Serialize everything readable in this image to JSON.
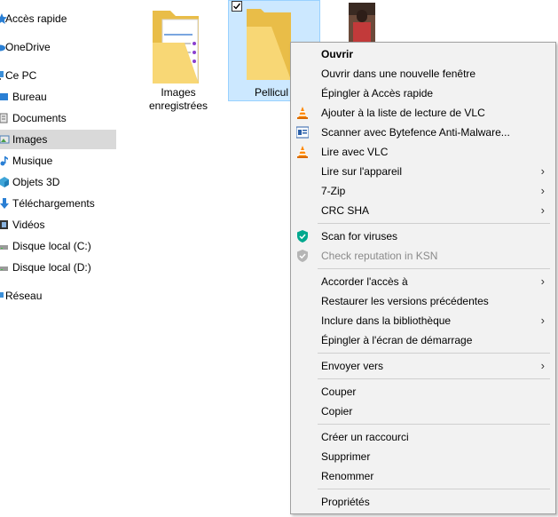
{
  "nav": {
    "items": [
      {
        "label": "Accès rapide",
        "icon": "star-icon"
      },
      {
        "label": "OneDrive",
        "icon": "cloud-icon"
      },
      {
        "label": "Ce PC",
        "icon": "computer-icon"
      },
      {
        "label": "Bureau",
        "icon": "desktop-icon"
      },
      {
        "label": "Documents",
        "icon": "documents-icon"
      },
      {
        "label": "Images",
        "icon": "pictures-icon"
      },
      {
        "label": "Musique",
        "icon": "music-icon"
      },
      {
        "label": "Objets 3D",
        "icon": "cube-icon"
      },
      {
        "label": "Téléchargements",
        "icon": "download-icon"
      },
      {
        "label": "Vidéos",
        "icon": "video-icon"
      },
      {
        "label": "Disque local (C:)",
        "icon": "drive-icon"
      },
      {
        "label": "Disque local (D:)",
        "icon": "drive-icon"
      },
      {
        "label": "Réseau",
        "icon": "network-icon"
      }
    ],
    "selected": "Images"
  },
  "files": {
    "images_enregistrees": {
      "line1": "Images",
      "line2": "enregistrées"
    },
    "pellicule": {
      "label": "Pellicul"
    }
  },
  "context_menu": {
    "items": [
      {
        "label": "Ouvrir",
        "bold": true
      },
      {
        "label": "Ouvrir dans une nouvelle fenêtre"
      },
      {
        "label": "Épingler à Accès rapide"
      },
      {
        "label": "Ajouter à la liste de lecture de VLC",
        "icon": "vlc-icon"
      },
      {
        "label": "Scanner avec Bytefence Anti-Malware...",
        "icon": "bytefence-icon"
      },
      {
        "label": "Lire avec VLC",
        "icon": "vlc-icon"
      },
      {
        "label": "Lire sur l'appareil",
        "submenu": true
      },
      {
        "label": "7-Zip",
        "submenu": true
      },
      {
        "label": "CRC SHA",
        "submenu": true
      },
      {
        "label": "Scan for viruses",
        "icon": "kaspersky-shield-icon"
      },
      {
        "label": "Check reputation in KSN",
        "icon": "kaspersky-shield-gray-icon",
        "disabled": true
      },
      {
        "label": "Accorder l'accès à",
        "submenu": true
      },
      {
        "label": "Restaurer les versions précédentes"
      },
      {
        "label": "Inclure dans la bibliothèque",
        "submenu": true
      },
      {
        "label": "Épingler à l'écran de démarrage"
      },
      {
        "label": "Envoyer vers",
        "submenu": true
      },
      {
        "label": "Couper"
      },
      {
        "label": "Copier"
      },
      {
        "label": "Créer un raccourci"
      },
      {
        "label": "Supprimer"
      },
      {
        "label": "Renommer"
      },
      {
        "label": "Propriétés"
      }
    ],
    "arrow": "›"
  },
  "colors": {
    "selection": "#cce8ff",
    "nav_selected": "#d9d9d9",
    "menu_bg": "#f2f2f2",
    "folder": "#f8d775",
    "vlc": "#ff8800",
    "kaspersky": "#00a88e"
  }
}
